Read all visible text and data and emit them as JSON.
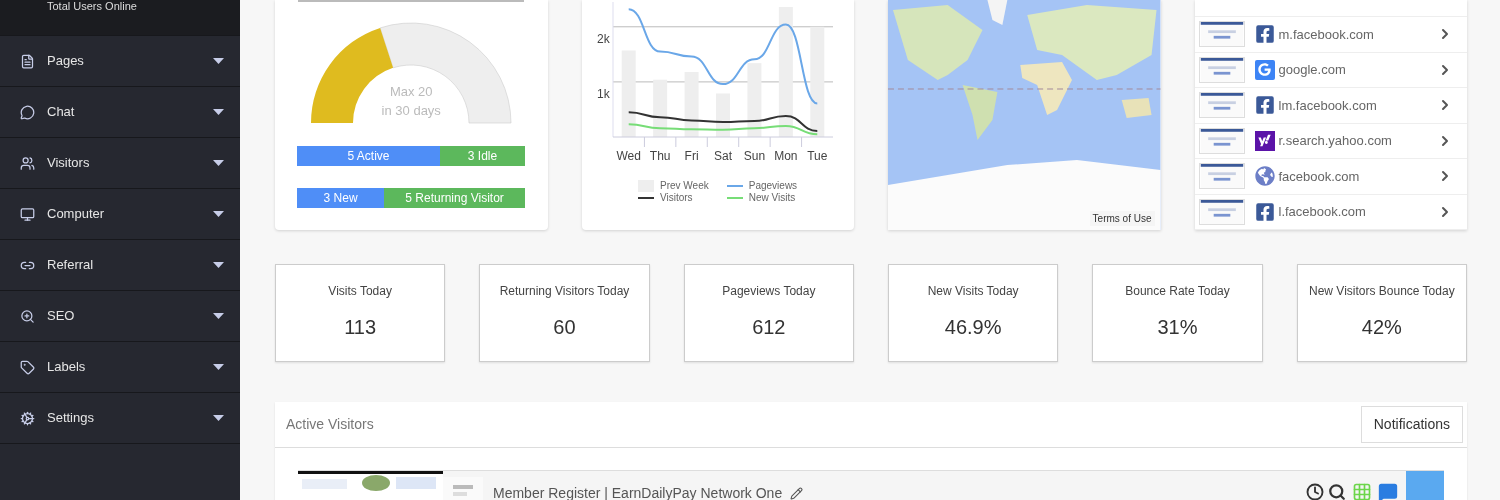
{
  "sidebar": {
    "top_label": "Total Users Online",
    "items": [
      {
        "label": "Pages",
        "kind": "pages"
      },
      {
        "label": "Chat",
        "kind": "chat"
      },
      {
        "label": "Visitors",
        "kind": "visitors"
      },
      {
        "label": "Computer",
        "kind": "computer"
      },
      {
        "label": "Referral",
        "kind": "referral"
      },
      {
        "label": "SEO",
        "kind": "seo"
      },
      {
        "label": "Labels",
        "kind": "labels"
      },
      {
        "label": "Settings",
        "kind": "settings"
      }
    ]
  },
  "gauge": {
    "level": 0.4,
    "caption_1": "Max 20",
    "caption_2": "in 30 days",
    "bars": [
      {
        "level": 0.625,
        "fill_label": "5 Active",
        "rest_label": "3 Idle"
      },
      {
        "level": 0.38,
        "fill_label": "3 New",
        "rest_label": "5 Returning Visitor"
      }
    ]
  },
  "traffic_chart": {
    "chart_data": {
      "type": "line",
      "categories": [
        "Wed",
        "Thu",
        "Fri",
        "Sat",
        "Sun",
        "Mon",
        "Tue"
      ],
      "ylim": [
        0,
        2.45
      ],
      "yticks": [
        {
          "value": 1,
          "label": "1k"
        },
        {
          "value": 2,
          "label": "2k"
        }
      ],
      "series": [
        {
          "name": "Prev Week",
          "type": "bar",
          "color": "#eeeeee",
          "values": [
            1.57,
            1.04,
            1.18,
            0.79,
            1.34,
            2.36,
            2.0
          ]
        },
        {
          "name": "Pageviews",
          "color": "#6aa7e8",
          "values": [
            2.32,
            1.55,
            1.46,
            0.96,
            1.41,
            2.04,
            0.61
          ]
        },
        {
          "name": "Visitors",
          "color": "#333333",
          "values": [
            0.45,
            0.36,
            0.3,
            0.27,
            0.29,
            0.38,
            0.11
          ]
        },
        {
          "name": "New Visits",
          "color": "#77dd77",
          "values": [
            0.23,
            0.16,
            0.14,
            0.13,
            0.16,
            0.2,
            0.05
          ]
        }
      ]
    }
  },
  "map": {
    "kind": "picture",
    "terms_link": "Terms of Use"
  },
  "referrers": [
    {
      "domain": "m.facebook.com",
      "kind": "facebook"
    },
    {
      "domain": "google.com",
      "kind": "google"
    },
    {
      "domain": "lm.facebook.com",
      "kind": "facebook"
    },
    {
      "domain": "r.search.yahoo.com",
      "kind": "yahoo"
    },
    {
      "domain": "facebook.com",
      "kind": "globe"
    },
    {
      "domain": "l.facebook.com",
      "kind": "facebook"
    }
  ],
  "stats": [
    {
      "label": "Visits Today",
      "value": "113"
    },
    {
      "label": "Returning Visitors Today",
      "value": "60"
    },
    {
      "label": "Pageviews Today",
      "value": "612"
    },
    {
      "label": "New Visits Today",
      "value": "46.9%"
    },
    {
      "label": "Bounce Rate Today",
      "value": "31%"
    },
    {
      "label": "New Visitors Bounce Today",
      "value": "42%"
    }
  ],
  "active_visitors": {
    "title": "Active Visitors",
    "notifications_button": "Notifications",
    "rows": [
      {
        "page_title": "Member Register | EarnDailyPay Network One"
      }
    ]
  }
}
